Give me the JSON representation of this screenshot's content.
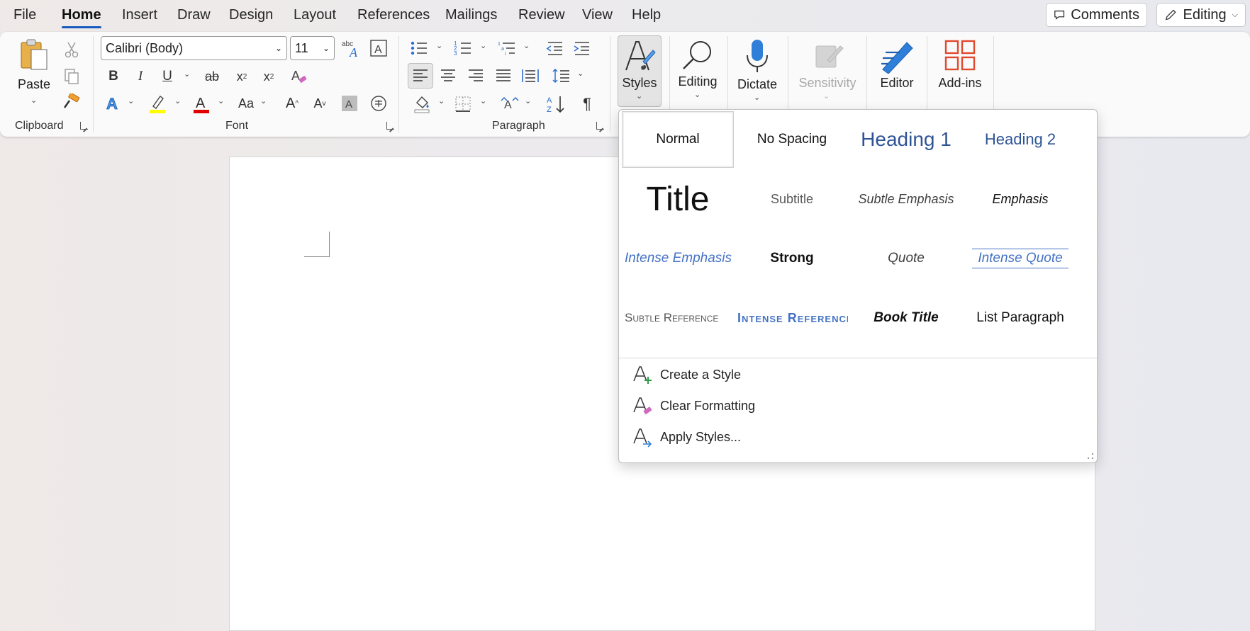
{
  "menu": {
    "tabs": [
      "File",
      "Home",
      "Insert",
      "Draw",
      "Design",
      "Layout",
      "References",
      "Mailings",
      "Review",
      "View",
      "Help"
    ],
    "active": "Home",
    "comments_label": "Comments",
    "editing_label": "Editing"
  },
  "ribbon": {
    "clipboard": {
      "paste_label": "Paste",
      "group_label": "Clipboard"
    },
    "font": {
      "font_name": "Calibri (Body)",
      "font_size": "11",
      "group_label": "Font"
    },
    "paragraph": {
      "group_label": "Paragraph"
    },
    "styles_label": "Styles",
    "editing_label": "Editing",
    "dictate_label": "Dictate",
    "sensitivity_label": "Sensitivity",
    "editor_label": "Editor",
    "addins_label": "Add-ins",
    "colors": {
      "accent": "#185abd",
      "highlight": "#ffff00",
      "font_color": "#e00000",
      "addins": "#e0492e"
    }
  },
  "styles_gallery": {
    "items": [
      "Normal",
      "No Spacing",
      "Heading 1",
      "Heading 2",
      "Title",
      "Subtitle",
      "Subtle Emphasis",
      "Emphasis",
      "Intense Emphasis",
      "Strong",
      "Quote",
      "Intense Quote",
      "Subtle Reference",
      "Intense Reference",
      "Book Title",
      "List Paragraph"
    ],
    "selected": "Normal",
    "commands": [
      "Create a Style",
      "Clear Formatting",
      "Apply Styles..."
    ],
    "colors": {
      "heading": "#2f5496",
      "intense": "#4472c4",
      "subtle": "#595959"
    }
  }
}
